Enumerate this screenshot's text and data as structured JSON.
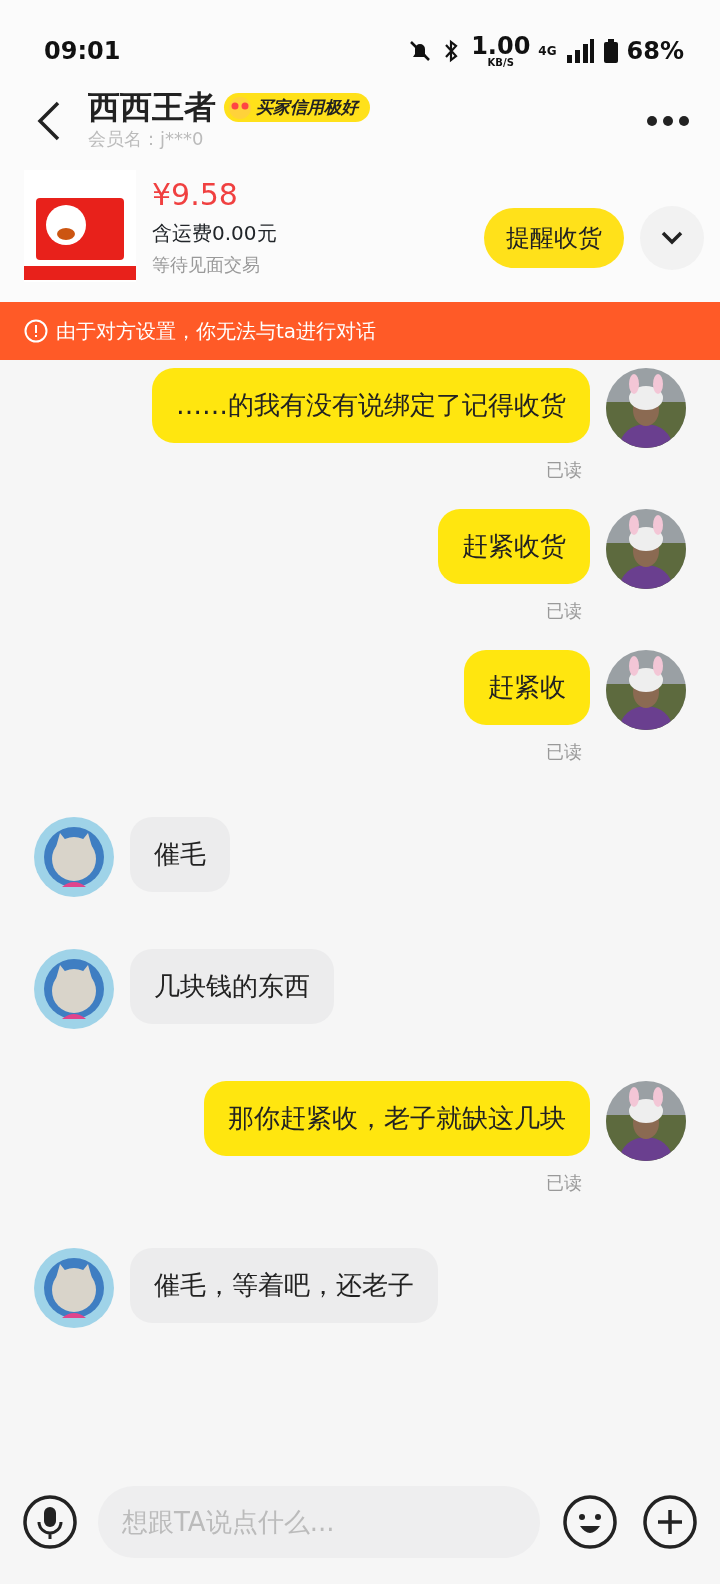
{
  "status_bar": {
    "time": "09:01",
    "speed": "1.00",
    "speed_unit": "KB/S",
    "network": "4G",
    "battery": "68%"
  },
  "header": {
    "name": "西西王者",
    "badge": "买家信用极好",
    "member": "会员名：j***0"
  },
  "product": {
    "price": "¥9.58",
    "shipping": "含运费0.00元",
    "status": "等待见面交易",
    "action": "提醒收货"
  },
  "notice": {
    "text": "由于对方设置，你无法与ta进行对话"
  },
  "messages": [
    {
      "kind": "sent",
      "text": "……的我有没有说绑定了记得收货",
      "read": "已读"
    },
    {
      "kind": "sent",
      "text": "赶紧收货",
      "read": "已读"
    },
    {
      "kind": "sent",
      "text": "赶紧收",
      "read": "已读"
    },
    {
      "kind": "received",
      "text": "催毛"
    },
    {
      "kind": "received",
      "text": "几块钱的东西"
    },
    {
      "kind": "sent",
      "text": "那你赶紧收，老子就缺这几块",
      "read": "已读"
    },
    {
      "kind": "received",
      "text": "催毛，等着吧，还老子"
    }
  ],
  "input": {
    "placeholder": "想跟TA说点什么..."
  }
}
